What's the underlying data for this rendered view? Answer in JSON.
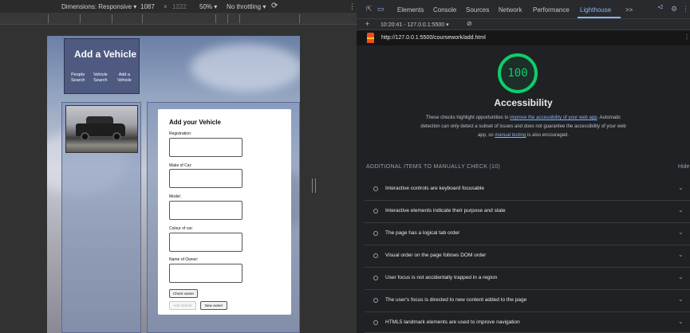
{
  "device_toolbar": {
    "dimensions": "Dimensions: Responsive ▾",
    "width": "1087",
    "times": "×",
    "height": "1222",
    "zoom": "50% ▾",
    "throttling": "No throttling ▾",
    "rotate_icon": "⟳",
    "more_icon": "⋮"
  },
  "site": {
    "title": "Add a Vehicle",
    "nav": [
      {
        "line1": "People",
        "line2": "Search"
      },
      {
        "line1": "Vehicle",
        "line2": "Search"
      },
      {
        "line1": "Add a",
        "line2": "Vehicle"
      }
    ],
    "form": {
      "title": "Add your Vehicle",
      "fields": [
        "Registration:",
        "Make of Car:",
        "Model:",
        "Colour of car:",
        "Name of Owner:"
      ],
      "check_owner": "Check owner",
      "add_vehicle": "Add Vehicle",
      "new_owner": "New owner"
    }
  },
  "devtools": {
    "tabs": [
      "Elements",
      "Console",
      "Sources",
      "Network",
      "Performance",
      "Lighthouse"
    ],
    "active_tab": "Lighthouse",
    "overflow": ">>",
    "issues_badge": "▪2",
    "report_time": "10:20:41 - 127.0.0.1:5500 ▾",
    "plus_icon": "+",
    "url": "http://127.0.0.1:5500/coursework/add.html",
    "url_more": "⋮",
    "score": "100",
    "category": "Accessibility",
    "desc_part1": "These checks highlight opportunities to ",
    "desc_link1": "improve the accessibility of your web app",
    "desc_part2": ". Automatic detection can only detect a subset of issues and does not guarantee the accessibility of your web app, so ",
    "desc_link2": "manual testing",
    "desc_part3": " is also encouraged.",
    "manual_heading": "ADDITIONAL ITEMS TO MANUALLY CHECK (10)",
    "hide": "Hide",
    "items": [
      "Interactive controls are keyboard focusable",
      "Interactive elements indicate their purpose and state",
      "The page has a logical tab order",
      "Visual order on the page follows DOM order",
      "User focus is not accidentally trapped in a region",
      "The user's focus is directed to new content added to the page",
      "HTML5 landmark elements are used to improve navigation"
    ],
    "colors": {
      "score_green": "#0cce6b",
      "link_blue": "#8ab4f8",
      "panel_bg": "#202124"
    }
  }
}
